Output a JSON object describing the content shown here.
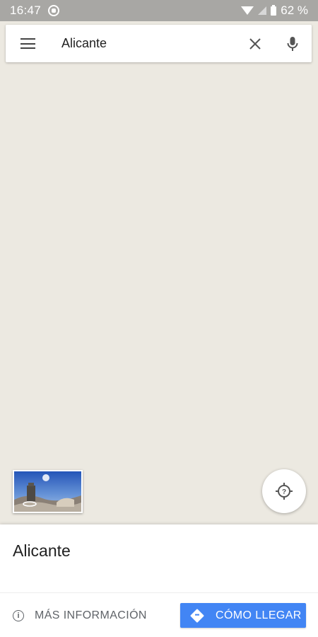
{
  "status_bar": {
    "time": "16:47",
    "battery": "62 %",
    "icons": [
      "whatsapp-icon",
      "wifi-icon",
      "signal-icon",
      "battery-icon"
    ]
  },
  "search": {
    "value": "Alicante",
    "menu_icon": "hamburger-menu-icon",
    "clear_icon": "close-icon",
    "voice_icon": "microphone-icon"
  },
  "map": {
    "background_color": "#ece9e1",
    "streetview_thumbnail": "street-view-panorama",
    "location_button_icon": "location-unknown-icon"
  },
  "place_sheet": {
    "title": "Alicante",
    "more_info_label": "MÁS INFORMACIÓN",
    "directions_label": "CÓMO LLEGAR",
    "accent_color": "#4285f4"
  }
}
